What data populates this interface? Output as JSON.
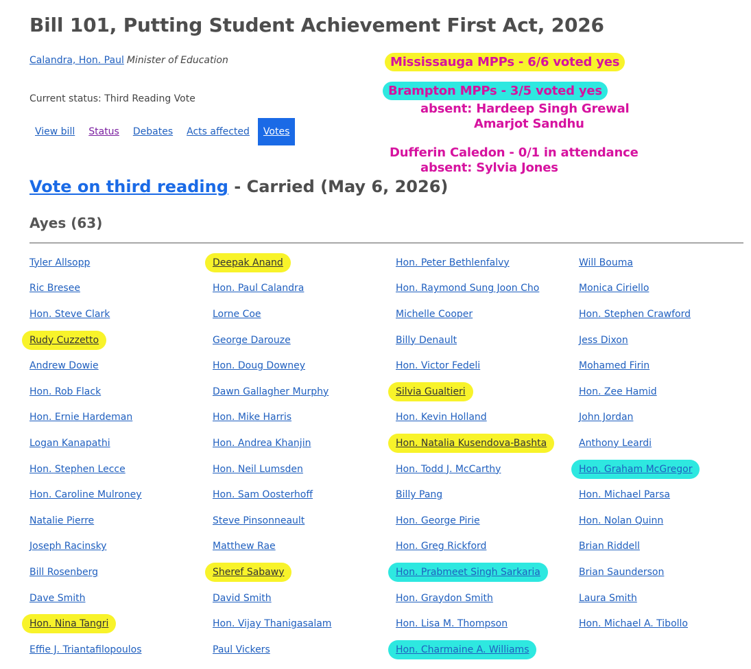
{
  "bill": {
    "title": "Bill 101, Putting Student Achievement First Act, 2026",
    "sponsor_name": "Calandra, Hon. Paul",
    "sponsor_role": "Minister of Education",
    "status": "Current status: Third Reading Vote"
  },
  "tabs": [
    {
      "label": "View bill"
    },
    {
      "label": "Status"
    },
    {
      "label": "Debates"
    },
    {
      "label": "Acts affected"
    },
    {
      "label": "Votes"
    }
  ],
  "vote": {
    "link_text": "Vote on third reading",
    "result_text": " - Carried (May 6, 2026)",
    "ayes_heading": "Ayes (63)"
  },
  "annotations": {
    "mississauga": "Mississauga MPPs - 6/6 voted yes",
    "brampton": "Brampton MPPs - 3/5 voted yes",
    "brampton_absent_1": "absent: Hardeep Singh Grewal",
    "brampton_absent_2": "Amarjot Sandhu",
    "dufferin": "Dufferin Caledon - 0/1 in attendance",
    "dufferin_absent": "absent: Sylvia Jones"
  },
  "colors": {
    "link": "#1f5fbf",
    "active_tab": "#1a6ae6",
    "highlight_yellow": "#f8f32a",
    "highlight_cyan": "#2ee8e0",
    "annotation_text": "#d6129f"
  },
  "members": [
    {
      "name": "Tyler Allsopp",
      "highlight": ""
    },
    {
      "name": "Deepak Anand",
      "highlight": "yellow"
    },
    {
      "name": "Hon. Peter Bethlenfalvy",
      "highlight": ""
    },
    {
      "name": "Will Bouma",
      "highlight": ""
    },
    {
      "name": "Ric Bresee",
      "highlight": ""
    },
    {
      "name": "Hon. Paul Calandra",
      "highlight": ""
    },
    {
      "name": "Hon. Raymond Sung Joon Cho",
      "highlight": ""
    },
    {
      "name": "Monica Ciriello",
      "highlight": ""
    },
    {
      "name": "Hon. Steve Clark",
      "highlight": ""
    },
    {
      "name": "Lorne Coe",
      "highlight": ""
    },
    {
      "name": "Michelle Cooper",
      "highlight": ""
    },
    {
      "name": "Hon. Stephen Crawford",
      "highlight": ""
    },
    {
      "name": "Rudy Cuzzetto",
      "highlight": "yellow"
    },
    {
      "name": "George Darouze",
      "highlight": ""
    },
    {
      "name": "Billy Denault",
      "highlight": ""
    },
    {
      "name": "Jess Dixon",
      "highlight": ""
    },
    {
      "name": "Andrew Dowie",
      "highlight": ""
    },
    {
      "name": "Hon. Doug Downey",
      "highlight": ""
    },
    {
      "name": "Hon. Victor Fedeli",
      "highlight": ""
    },
    {
      "name": "Mohamed Firin",
      "highlight": ""
    },
    {
      "name": "Hon. Rob Flack",
      "highlight": ""
    },
    {
      "name": "Dawn Gallagher Murphy",
      "highlight": ""
    },
    {
      "name": "Silvia Gualtieri",
      "highlight": "yellow"
    },
    {
      "name": "Hon. Zee Hamid",
      "highlight": ""
    },
    {
      "name": "Hon. Ernie Hardeman",
      "highlight": ""
    },
    {
      "name": "Hon. Mike Harris",
      "highlight": ""
    },
    {
      "name": "Hon. Kevin Holland",
      "highlight": ""
    },
    {
      "name": "John Jordan",
      "highlight": ""
    },
    {
      "name": "Logan Kanapathi",
      "highlight": ""
    },
    {
      "name": "Hon. Andrea Khanjin",
      "highlight": ""
    },
    {
      "name": "Hon. Natalia Kusendova-Bashta",
      "highlight": "yellow"
    },
    {
      "name": "Anthony Leardi",
      "highlight": ""
    },
    {
      "name": "Hon. Stephen Lecce",
      "highlight": ""
    },
    {
      "name": "Hon. Neil Lumsden",
      "highlight": ""
    },
    {
      "name": "Hon. Todd J. McCarthy",
      "highlight": ""
    },
    {
      "name": "Hon. Graham McGregor",
      "highlight": "cyan"
    },
    {
      "name": "Hon. Caroline Mulroney",
      "highlight": ""
    },
    {
      "name": "Hon. Sam Oosterhoff",
      "highlight": ""
    },
    {
      "name": "Billy Pang",
      "highlight": ""
    },
    {
      "name": "Hon. Michael Parsa",
      "highlight": ""
    },
    {
      "name": "Natalie Pierre",
      "highlight": ""
    },
    {
      "name": "Steve Pinsonneault",
      "highlight": ""
    },
    {
      "name": "Hon. George Pirie",
      "highlight": ""
    },
    {
      "name": "Hon. Nolan Quinn",
      "highlight": ""
    },
    {
      "name": "Joseph Racinsky",
      "highlight": ""
    },
    {
      "name": "Matthew Rae",
      "highlight": ""
    },
    {
      "name": "Hon. Greg Rickford",
      "highlight": ""
    },
    {
      "name": "Brian Riddell",
      "highlight": ""
    },
    {
      "name": "Bill Rosenberg",
      "highlight": ""
    },
    {
      "name": "Sheref Sabawy",
      "highlight": "yellow"
    },
    {
      "name": "Hon. Prabmeet Singh Sarkaria",
      "highlight": "cyan"
    },
    {
      "name": "Brian Saunderson",
      "highlight": ""
    },
    {
      "name": "Dave Smith",
      "highlight": ""
    },
    {
      "name": "David Smith",
      "highlight": ""
    },
    {
      "name": "Hon. Graydon Smith",
      "highlight": ""
    },
    {
      "name": "Laura Smith",
      "highlight": ""
    },
    {
      "name": "Hon. Nina Tangri",
      "highlight": "yellow"
    },
    {
      "name": "Hon. Vijay Thanigasalam",
      "highlight": ""
    },
    {
      "name": "Hon. Lisa M. Thompson",
      "highlight": ""
    },
    {
      "name": "Hon. Michael A. Tibollo",
      "highlight": ""
    },
    {
      "name": "Effie J. Triantafilopoulos",
      "highlight": ""
    },
    {
      "name": "Paul Vickers",
      "highlight": ""
    },
    {
      "name": "Hon. Charmaine A. Williams",
      "highlight": "cyan"
    }
  ]
}
